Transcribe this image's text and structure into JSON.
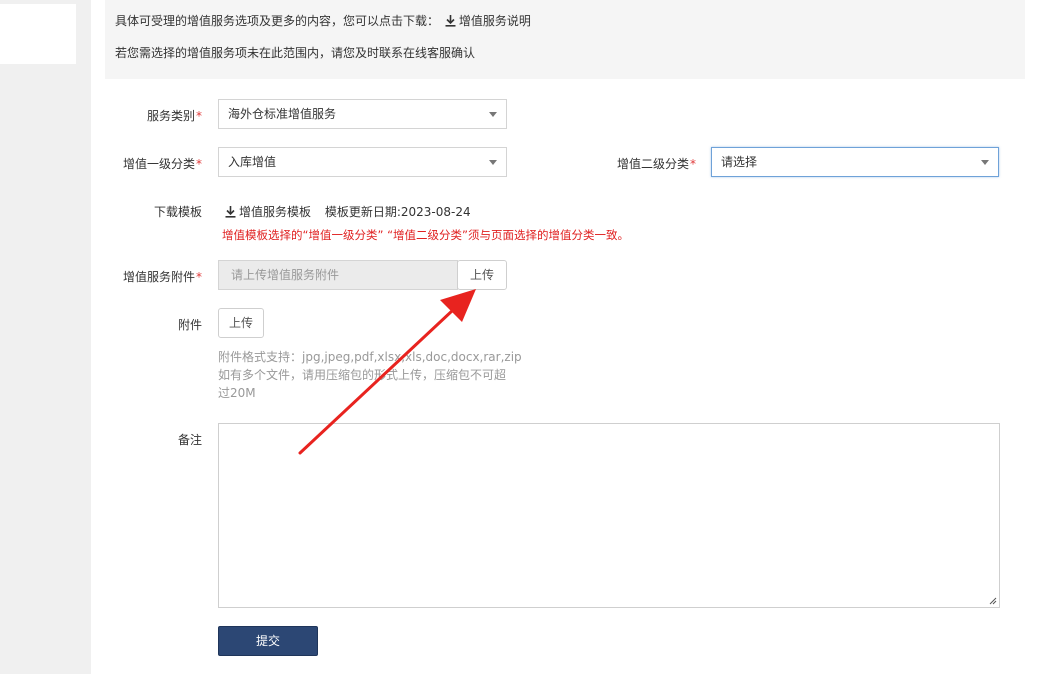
{
  "notice": {
    "line1_text": "具体可受理的增值服务选项及更多的内容，您可以点击下载：",
    "line1_link": "增值服务说明",
    "line2_text": "若您需选择的增值服务项未在此范围内，请您及时联系在线客服确认"
  },
  "form": {
    "service_type": {
      "label": "服务类别",
      "value": "海外仓标准增值服务"
    },
    "level1": {
      "label": "增值一级分类",
      "value": "入库增值"
    },
    "level2": {
      "label": "增值二级分类",
      "value": "请选择"
    },
    "template": {
      "label": "下载模板",
      "link": "增值服务模板",
      "updated": "模板更新日期:2023-08-24",
      "warning": "增值模板选择的“增值一级分类” “增值二级分类”须与页面选择的增值分类一致。"
    },
    "attachment_service": {
      "label": "增值服务附件",
      "placeholder": "请上传增值服务附件",
      "upload_label": "上传"
    },
    "attachment": {
      "label": "附件",
      "upload_label": "上传",
      "hint_lines": [
        "附件格式支持：jpg,jpeg,pdf,xlsx,xls,doc,docx,rar,zip",
        "如有多个文件，请用压缩包的形式上传，压缩包不可超",
        "过20M"
      ]
    },
    "remark": {
      "label": "备注",
      "value": ""
    },
    "required_mark": "*",
    "submit_label": "提交"
  },
  "colors": {
    "required": "#e03a3a",
    "warning": "#e02020",
    "submit_bg": "#2c4774",
    "annotation_arrow": "#e8231f"
  }
}
